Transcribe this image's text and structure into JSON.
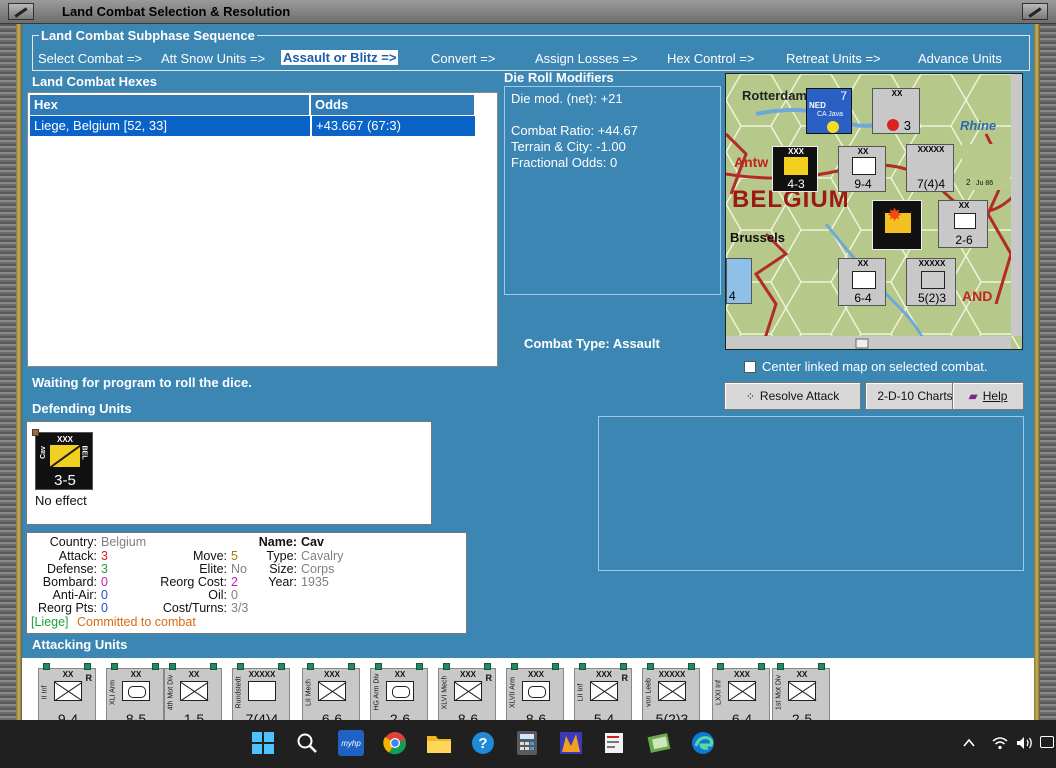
{
  "window": {
    "title": "Land Combat Selection & Resolution"
  },
  "subphase": {
    "title": "Land Combat Subphase Sequence",
    "steps": [
      "Select Combat =>",
      "Att Snow Units =>",
      "Assault or Blitz =>",
      "Convert =>",
      "Assign Losses =>",
      "Hex Control =>",
      "Retreat Units =>",
      "Advance Units"
    ]
  },
  "hexes": {
    "label": "Land Combat Hexes",
    "col_hex": "Hex",
    "col_odds": "Odds",
    "rows": [
      {
        "hex": "Liege, Belgium [52, 33]",
        "odds": "+43.667 (67:3)"
      }
    ]
  },
  "die_roll": {
    "label": "Die Roll Modifiers",
    "net": "Die mod. (net): +21",
    "combat_ratio": "Combat Ratio: +44.67",
    "terrain": "Terrain & City: -1.00",
    "fractional": "Fractional Odds: 0"
  },
  "combat_type": "Combat Type:  Assault",
  "status": "Waiting for program to roll the dice.",
  "center_map_label": "Center linked map on selected combat.",
  "buttons": {
    "resolve": "Resolve Attack",
    "charts": "2-D-10 Charts",
    "help": "Help"
  },
  "map": {
    "labels": {
      "rotterdam": "Rotterdam",
      "rhine": "Rhine",
      "antwerp": "Antw",
      "belgium": "BELGIUM",
      "brussels": "Brussels",
      "land": "AND"
    },
    "units": [
      {
        "size": "XX",
        "strength": "7",
        "name": "CA Java",
        "nation": "NED"
      },
      {
        "size": "XX",
        "strength": "3"
      },
      {
        "size": "XXX",
        "strength": "4-3",
        "name": "II Inf",
        "nation": "BEL"
      },
      {
        "size": "XX",
        "strength": "9-4",
        "name": "II Inf"
      },
      {
        "size": "XXXXX",
        "strength": "7(4)4",
        "name": "Rundstedt"
      },
      {
        "size": "XX",
        "strength": "2-6",
        "name": "III Arm"
      },
      {
        "size": "XX",
        "strength": "6-4",
        "name": "XXVI Inf"
      },
      {
        "size": "XXXXX",
        "strength": "5(2)3",
        "name": "von Leeb"
      },
      {
        "strength": "4"
      },
      {
        "strength": "2",
        "name": "Ju 86"
      }
    ]
  },
  "defending": {
    "label": "Defending Units",
    "unit": {
      "size": "XXX",
      "type_short": "Cav",
      "nation": "BEL",
      "strength": "3-5",
      "result": "No effect"
    }
  },
  "info": {
    "country_label": "Country:",
    "country": "Belgium",
    "attack_label": "Attack:",
    "attack": "3",
    "defense_label": "Defense:",
    "defense": "3",
    "bombard_label": "Bombard:",
    "bombard": "0",
    "antiair_label": "Anti-Air:",
    "antiair": "0",
    "reorg_pts_label": "Reorg Pts:",
    "reorg_pts": "0",
    "move_label": "Move:",
    "move": "5",
    "elite_label": "Elite:",
    "elite": "No",
    "reorg_cost_label": "Reorg Cost:",
    "reorg_cost": "2",
    "oil_label": "Oil:",
    "oil": "0",
    "cost_turns_label": "Cost/Turns:",
    "cost_turns": "3/3",
    "name_label": "Name:",
    "name": "Cav",
    "type_label": "Type:",
    "type": "Cavalry",
    "size_label": "Size:",
    "size": "Corps",
    "year_label": "Year:",
    "year": "1935",
    "location": "[Liege]",
    "status": "Committed to combat"
  },
  "attacking": {
    "label": "Attacking Units",
    "units": [
      {
        "size": "XX",
        "name": "II Inf",
        "strength": "9-4",
        "sym": "x",
        "r": "R"
      },
      {
        "size": "XX",
        "name": "XLI Arm",
        "strength": "8-5",
        "sym": "o",
        "r": ""
      },
      {
        "size": "XX",
        "name": "4th Mot Div",
        "strength": "1-5",
        "sym": "x",
        "r": ""
      },
      {
        "size": "XXXXX",
        "name": "Rundstedt",
        "strength": "7(4)4",
        "sym": "",
        "r": ""
      },
      {
        "size": "XXX",
        "name": "LII Mech",
        "strength": "6-6",
        "sym": "x",
        "r": ""
      },
      {
        "size": "XX",
        "name": "HG Arm Div",
        "strength": "2-6",
        "sym": "o",
        "r": ""
      },
      {
        "size": "XXX",
        "name": "XLVI Mech",
        "strength": "8-6",
        "sym": "x",
        "r": "R"
      },
      {
        "size": "XXX",
        "name": "XLVII Arm",
        "strength": "8-6",
        "sym": "o",
        "r": ""
      },
      {
        "size": "XXX",
        "name": "LII Inf",
        "strength": "5-4",
        "sym": "x",
        "r": "R"
      },
      {
        "size": "XXXXX",
        "name": "von Leeb",
        "strength": "5(2)3",
        "sym": "x",
        "r": ""
      },
      {
        "size": "XXX",
        "name": "LXXI Inf",
        "strength": "6-4",
        "sym": "x",
        "r": ""
      },
      {
        "size": "XX",
        "name": "1st Mot Div",
        "strength": "2-5",
        "sym": "x",
        "r": ""
      }
    ]
  },
  "taskbar": {
    "icons": [
      "windows-start-icon",
      "search-icon",
      "myhp-icon",
      "chrome-icon",
      "file-explorer-icon",
      "help-icon",
      "calculator-icon",
      "game-icon",
      "notes-icon",
      "app-icon",
      "edge-icon"
    ],
    "myhp_text": "myhp"
  }
}
